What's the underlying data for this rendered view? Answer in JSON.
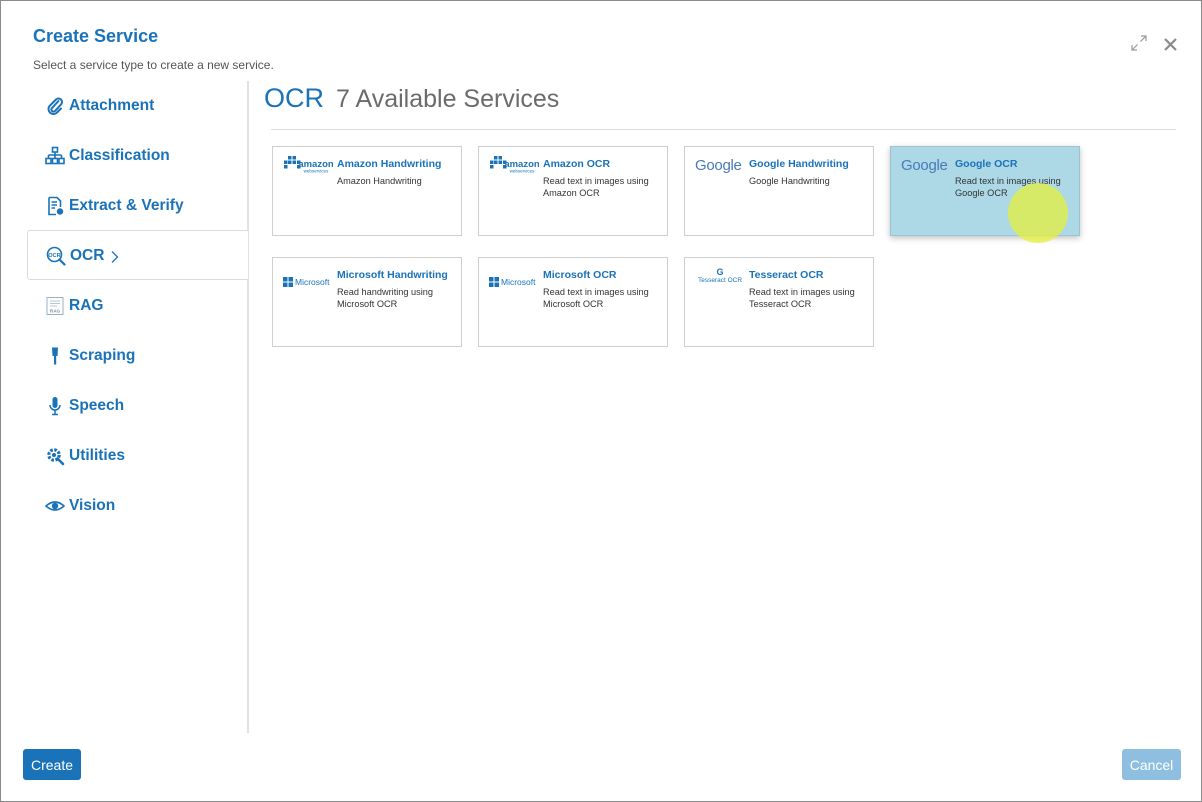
{
  "dialog": {
    "title": "Create Service",
    "subtitle": "Select a service type to create a new service."
  },
  "sidebar": {
    "items": [
      {
        "label": "Attachment",
        "icon": "paperclip-icon"
      },
      {
        "label": "Classification",
        "icon": "hierarchy-icon"
      },
      {
        "label": "Extract & Verify",
        "icon": "document-check-icon"
      },
      {
        "label": "OCR",
        "icon": "ocr-magnifier-icon",
        "active": true
      },
      {
        "label": "RAG",
        "icon": "rag-document-icon"
      },
      {
        "label": "Scraping",
        "icon": "brush-icon"
      },
      {
        "label": "Speech",
        "icon": "microphone-icon"
      },
      {
        "label": "Utilities",
        "icon": "gear-wrench-icon"
      },
      {
        "label": "Vision",
        "icon": "eye-icon"
      }
    ]
  },
  "main": {
    "category": "OCR",
    "count_label": "7 Available Services"
  },
  "cards": [
    {
      "name": "Amazon Handwriting",
      "desc": "Amazon Handwriting",
      "logo": "amazon-web-services-logo"
    },
    {
      "name": "Amazon OCR",
      "desc": "Read text in images using Amazon OCR",
      "logo": "amazon-web-services-logo"
    },
    {
      "name": "Google Handwriting",
      "desc": "Google Handwriting",
      "logo": "google-logo"
    },
    {
      "name": "Google OCR",
      "desc": "Read text in images using Google OCR",
      "logo": "google-logo",
      "hover": true
    },
    {
      "name": "Microsoft Handwriting",
      "desc": "Read handwriting using Microsoft OCR",
      "logo": "microsoft-logo"
    },
    {
      "name": "Microsoft OCR",
      "desc": "Read text in images using Microsoft OCR",
      "logo": "microsoft-logo"
    },
    {
      "name": "Tesseract OCR",
      "desc": "Read text in images using Tesseract OCR",
      "logo": "tesseract-logo"
    }
  ],
  "logos": {
    "google": "Google",
    "microsoft": "Microsoft",
    "amazon_top": "amazon",
    "amazon_bottom": "webservices",
    "tesseract": "Tesseract OCR",
    "tesseract_g": "G"
  },
  "footer": {
    "create_label": "Create",
    "cancel_label": "Cancel"
  },
  "colors": {
    "accent": "#1a73b8",
    "hover_card": "#add8e6",
    "cancel_button": "#8ebfe0"
  }
}
